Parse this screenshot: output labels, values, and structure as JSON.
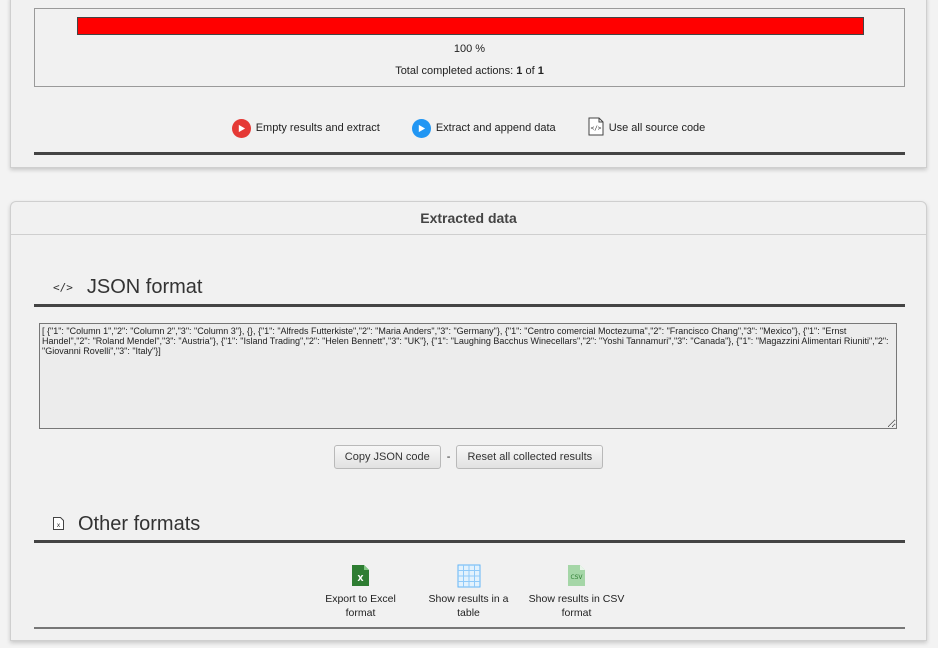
{
  "progress": {
    "percent_value": 1.0,
    "percent_label": "100 %",
    "total_prefix": "Total completed actions: ",
    "completed": "1",
    "of_word": " of ",
    "total": "1",
    "fill_color": "#ff0000"
  },
  "actions": [
    {
      "label": "Empty results and extract",
      "icon": "play-icon",
      "color": "#e53935"
    },
    {
      "label": "Extract and append data",
      "icon": "play-icon",
      "color": "#2196f3"
    },
    {
      "label": "Use all source code",
      "icon": "code-file-icon"
    }
  ],
  "extracted": {
    "header": "Extracted data",
    "json_section": {
      "title": "JSON format",
      "icon": "code-icon",
      "value": "[ {\"1\": \"Column 1\",\"2\": \"Column 2\",\"3\": \"Column 3\"}, {}, {\"1\": \"Alfreds Futterkiste\",\"2\": \"Maria Anders\",\"3\": \"Germany\"}, {\"1\": \"Centro comercial Moctezuma\",\"2\": \"Francisco Chang\",\"3\": \"Mexico\"}, {\"1\": \"Ernst Handel\",\"2\": \"Roland Mendel\",\"3\": \"Austria\"}, {\"1\": \"Island Trading\",\"2\": \"Helen Bennett\",\"3\": \"UK\"}, {\"1\": \"Laughing Bacchus Winecellars\",\"2\": \"Yoshi Tannamuri\",\"3\": \"Canada\"}, {\"1\": \"Magazzini Alimentari Riuniti\",\"2\": \"Giovanni Rovelli\",\"3\": \"Italy\"}]",
      "copy_label": "Copy JSON code",
      "separator": "-",
      "reset_label": "Reset all collected results"
    },
    "other_section": {
      "title": "Other formats",
      "icon": "excel-file-icon",
      "formats": [
        {
          "label": "Export to Excel format",
          "icon": "excel-icon"
        },
        {
          "label": "Show results in a table",
          "icon": "table-icon"
        },
        {
          "label": "Show results in CSV format",
          "icon": "csv-icon",
          "icon_text": "CSV"
        }
      ]
    }
  }
}
